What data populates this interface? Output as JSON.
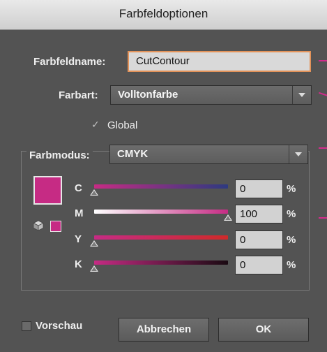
{
  "window": {
    "title": "Farbfeldoptionen"
  },
  "swatch_name": {
    "label": "Farbfeldname:",
    "value": "CutContour"
  },
  "color_type": {
    "label": "Farbart:",
    "value": "Volltonfarbe"
  },
  "global": {
    "label": "Global",
    "checked": true
  },
  "color_mode": {
    "label": "Farbmodus:",
    "value": "CMYK"
  },
  "swatch_color": "#c62b84",
  "channels": [
    {
      "label": "C",
      "value": "0",
      "unit": "%",
      "fraction": 0.0
    },
    {
      "label": "M",
      "value": "100",
      "unit": "%",
      "fraction": 1.0
    },
    {
      "label": "Y",
      "value": "0",
      "unit": "%",
      "fraction": 0.0
    },
    {
      "label": "K",
      "value": "0",
      "unit": "%",
      "fraction": 0.0
    }
  ],
  "preview": {
    "label": "Vorschau",
    "checked": false
  },
  "buttons": {
    "cancel": "Abbrechen",
    "ok": "OK"
  },
  "accent_marker_color": "#d42a8c"
}
